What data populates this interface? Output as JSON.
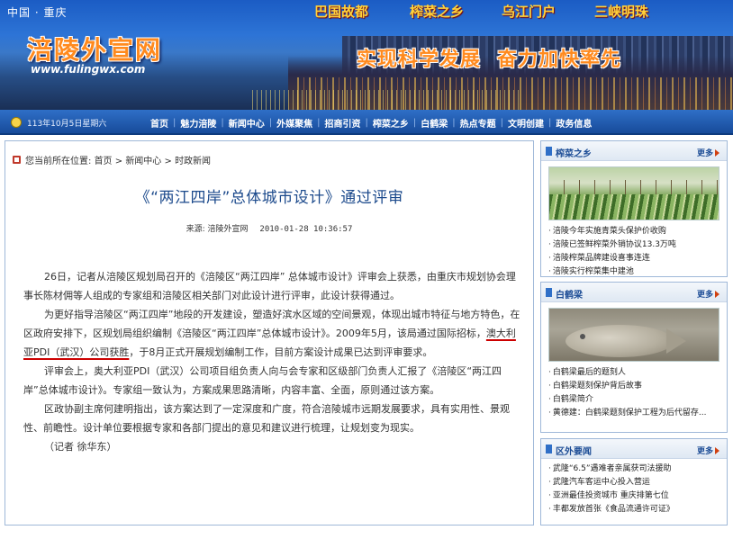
{
  "banner": {
    "china_cq": "中国 · 重庆",
    "site_title": "涪陵外宣网",
    "site_url": "www.fulingwx.com",
    "top_links": [
      "巴国故都",
      "榨菜之乡",
      "乌江门户",
      "三峡明珠"
    ],
    "slogan": [
      "实现科学发展",
      "奋力加快率先"
    ]
  },
  "nav": {
    "date": "113年10月5日星期六",
    "items": [
      "首页",
      "魅力涪陵",
      "新闻中心",
      "外媒聚焦",
      "招商引资",
      "榨菜之乡",
      "白鹤梁",
      "热点专题",
      "文明创建",
      "政务信息"
    ]
  },
  "breadcrumb": {
    "prefix": "您当前所在位置:",
    "items": [
      "首页",
      "新闻中心",
      "时政新闻"
    ],
    "sep": " > "
  },
  "article": {
    "title": "《“两江四岸”总体城市设计》通过评审",
    "source_label": "来源:",
    "source": "涪陵外宣网",
    "date": "2010-01-28 10:36:57",
    "p1": "26日，记者从涪陵区规划局召开的《涪陵区“两江四岸” 总体城市设计》评审会上获悉，由重庆市规划协会理事长陈材佣等人组成的专家组和涪陵区相关部门对此设计进行评审，此设计获得通过。",
    "p2_a": "为更好指导涪陵区“两江四岸”地段的开发建设，塑造好滨水区域的空间景观，体现出城市特征与地方特色，在区政府安排下，区规划局组织编制《涪陵区“两江四岸”总体城市设计》。2009年5月，该局通过国际招标，",
    "p2_highlight": "澳大利亚PDI（武汉）公司获胜",
    "p2_b": "，于8月正式开展规划编制工作，目前方案设计成果已达到评审要求。",
    "p3": "评审会上，奥大利亚PDI（武汉）公司项目组负责人向与会专家和区级部门负责人汇报了《涪陵区“两江四岸”总体城市设计》。专家组一致认为，方案成果思路清晰，内容丰富、全面，原则通过该方案。",
    "p4": "区政协副主席何建明指出，该方案达到了一定深度和广度，符合涪陵城市远期发展要求，具有实用性、景观性、前瞻性。设计单位要根据专家和各部门提出的意见和建议进行梳理，让规划变为现实。",
    "byline": "（记者  徐华东）"
  },
  "sidebar": {
    "more_label": "更多",
    "zhacai": {
      "title": "榨菜之乡",
      "items": [
        "涪陵今年实施青菜头保护价收购",
        "涪陵已签鲜榨菜外销协议13.3万吨",
        "涪陵榨菜品牌建设喜事连连",
        "涪陵实行榨菜集中建池"
      ]
    },
    "baiheliang": {
      "title": "白鹤梁",
      "items": [
        "白鹤梁最后的题刻人",
        "白鹤梁题刻保护背后故事",
        "白鹤梁简介",
        "黄德建：白鹤梁题刻保护工程为后代留存..."
      ]
    },
    "quwai": {
      "title": "区外要闻",
      "items": [
        "武隆“6.5”遇难者亲属获司法援助",
        "武隆汽车客运中心投入营运",
        "亚洲最佳投资城市 重庆排第七位",
        "丰都发放首张《食品流通许可证》"
      ]
    }
  }
}
